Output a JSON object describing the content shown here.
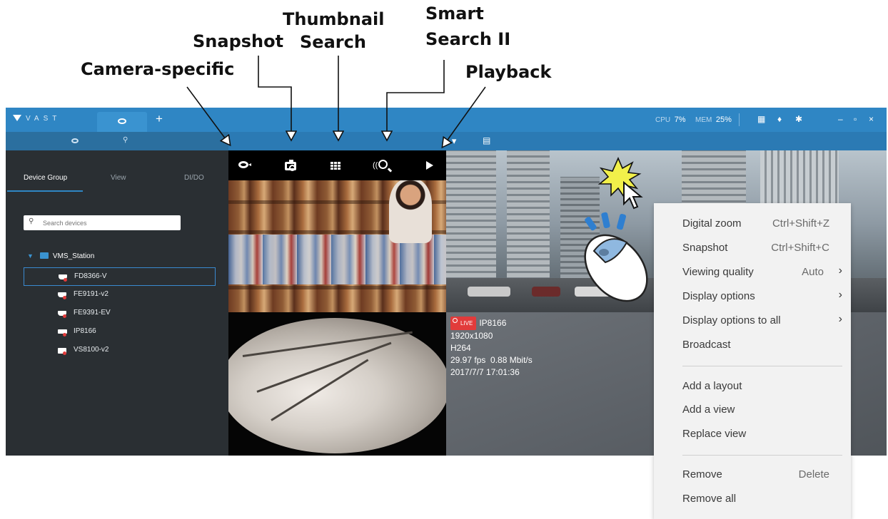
{
  "callouts": {
    "camera_specific": "Camera-specific",
    "snapshot": "Snapshot",
    "thumbnail_search": [
      "Thumbnail",
      "Search"
    ],
    "smart_search": [
      "Smart",
      "Search II"
    ],
    "playback": "Playback"
  },
  "titlebar": {
    "logo": "VAST",
    "add_tab": "+",
    "cpu_label": "CPU",
    "cpu_value": "7%",
    "mem_label": "MEM",
    "mem_value": "25%",
    "window_minimize": "–",
    "window_maximize": "▫",
    "window_close": "×"
  },
  "sidebar": {
    "tabs": [
      {
        "label": "Device Group"
      },
      {
        "label": "View"
      },
      {
        "label": "DI/DO"
      }
    ],
    "search": {
      "placeholder": "Search devices"
    },
    "tree": {
      "root": "VMS_Station",
      "devices": [
        {
          "name": "FD8366-V"
        },
        {
          "name": "FE9191-v2"
        },
        {
          "name": "FE9391-EV"
        },
        {
          "name": "IP8166"
        },
        {
          "name": "VS8100-v2"
        }
      ]
    }
  },
  "camera_toolbar": {
    "buttons": [
      "camera-specific",
      "snapshot",
      "thumbnail-search",
      "smart-search-ii",
      "playback"
    ]
  },
  "osd": {
    "live": "LIVE",
    "camera": "IP8166",
    "resolution": "1920x1080",
    "codec": "H264",
    "rate": "29.97 fps  0.88 Mbit/s",
    "timestamp": "2017/7/7 17:01:36"
  },
  "context_menu": {
    "items": [
      {
        "label": "Digital zoom",
        "shortcut": "Ctrl+Shift+Z"
      },
      {
        "label": "Snapshot",
        "shortcut": "Ctrl+Shift+C"
      },
      {
        "label": "Viewing quality",
        "value": "Auto"
      },
      {
        "label": "Display options"
      },
      {
        "label": "Display options to all"
      },
      {
        "label": "Broadcast"
      },
      {
        "label": "Add a layout"
      },
      {
        "label": "Add a view"
      },
      {
        "label": "Replace view"
      },
      {
        "label": "Remove",
        "shortcut": "Delete"
      },
      {
        "label": "Remove all"
      }
    ]
  },
  "colors": {
    "titlebar": "#2f86c4",
    "subbar": "#2b7ab4",
    "sidebar": "#2a2f33",
    "live_badge": "#e23b3b",
    "menu_bg": "#f2f2f2"
  }
}
